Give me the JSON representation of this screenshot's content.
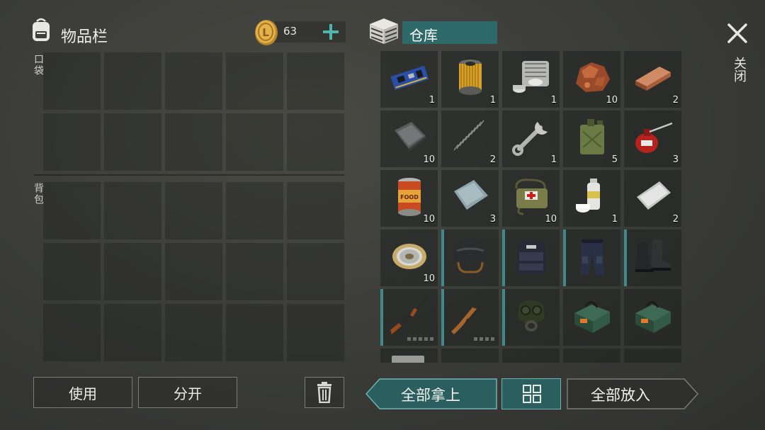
{
  "inventory": {
    "title": "物品栏",
    "coins": "63",
    "pocket_label": "口袋",
    "backpack_label": "背包",
    "use_label": "使用",
    "split_label": "分开"
  },
  "warehouse": {
    "title": "仓库",
    "close_label": "关闭",
    "take_all_label": "全部拿上",
    "put_all_label": "全部放入",
    "items": [
      {
        "name": "circuit-board-icon",
        "qty": "1"
      },
      {
        "name": "oil-filter-icon",
        "qty": "1"
      },
      {
        "name": "engine-block-icon",
        "qty": "1"
      },
      {
        "name": "copper-ore-icon",
        "qty": "10"
      },
      {
        "name": "copper-ingot-icon",
        "qty": "2"
      },
      {
        "name": "scrap-metal-icon",
        "qty": "10"
      },
      {
        "name": "spring-icon",
        "qty": "2"
      },
      {
        "name": "wrench-icon",
        "qty": "1"
      },
      {
        "name": "jerrycan-icon",
        "qty": "5"
      },
      {
        "name": "oil-can-icon",
        "qty": "3"
      },
      {
        "name": "canned-food-icon",
        "qty": "10"
      },
      {
        "name": "metal-plate-icon",
        "qty": "3"
      },
      {
        "name": "medkit-bag-icon",
        "qty": "10"
      },
      {
        "name": "spray-can-icon",
        "qty": "1"
      },
      {
        "name": "steel-sheet-icon",
        "qty": "2"
      },
      {
        "name": "wire-spool-icon",
        "qty": "10"
      },
      {
        "name": "helmet-icon",
        "qty": ""
      },
      {
        "name": "police-vest-icon",
        "qty": ""
      },
      {
        "name": "police-pants-icon",
        "qty": ""
      },
      {
        "name": "boots-icon",
        "qty": ""
      },
      {
        "name": "ak-rifle-icon",
        "qty": ""
      },
      {
        "name": "sks-rifle-icon",
        "qty": ""
      },
      {
        "name": "gas-mask-icon",
        "qty": ""
      },
      {
        "name": "ammo-box-icon",
        "qty": ""
      },
      {
        "name": "ammo-box-icon",
        "qty": ""
      }
    ]
  },
  "colors": {
    "accent": "#2e6a6a",
    "accent_border": "#6fb3b3",
    "background": "#3a3b37"
  }
}
